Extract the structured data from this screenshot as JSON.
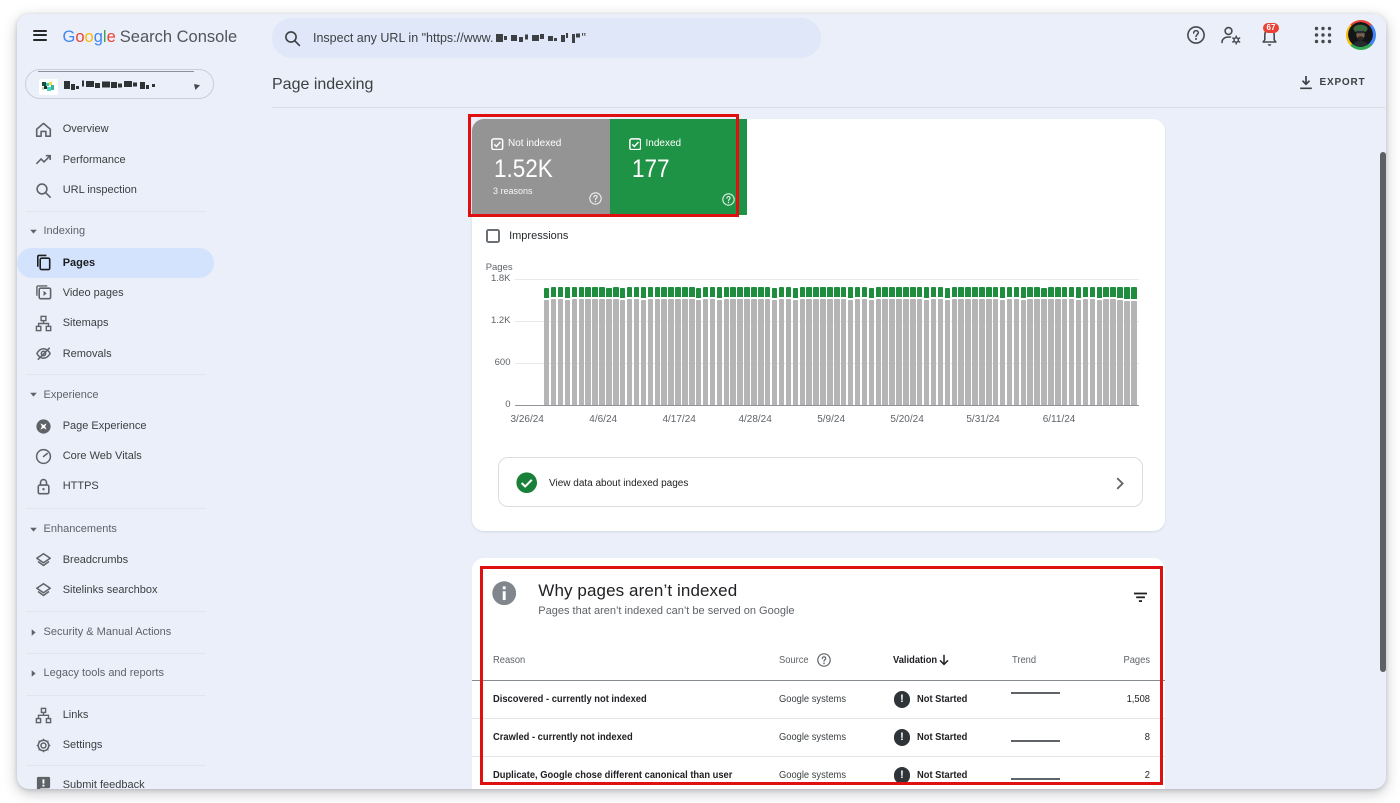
{
  "colors": {
    "window_bg": "#eaeff9",
    "search_bg": "#dfe7f8",
    "selected_pill": "#d3e3fd",
    "tile_gray": "#949494",
    "tile_green": "#1f9345",
    "bar_gray": "#b5b5b5",
    "bar_green": "#1e8e3e",
    "check_green": "#188038",
    "badge_red": "#e94235",
    "annotation_red": "#e01010"
  },
  "topbar": {
    "logo_google_letters": [
      {
        "ch": "G",
        "color": "#4285F4"
      },
      {
        "ch": "o",
        "color": "#EA4335"
      },
      {
        "ch": "o",
        "color": "#FBBC05"
      },
      {
        "ch": "g",
        "color": "#4285F4"
      },
      {
        "ch": "l",
        "color": "#34A853"
      },
      {
        "ch": "e",
        "color": "#EA4335"
      }
    ],
    "logo_suffix": "Search Console",
    "search_placeholder_prefix": "Inspect any URL in \"https://www.",
    "search_placeholder_suffix": "\"",
    "notifications_count": "67"
  },
  "page_header": {
    "title": "Page indexing",
    "export_label": "EXPORT"
  },
  "sidebar": {
    "items": [
      {
        "type": "item",
        "icon": "home-icon",
        "label": "Overview"
      },
      {
        "type": "item",
        "icon": "performance-icon",
        "label": "Performance"
      },
      {
        "type": "item",
        "icon": "url-inspection-icon",
        "label": "URL inspection"
      },
      {
        "type": "divider"
      },
      {
        "type": "section",
        "label": "Indexing",
        "expanded": true
      },
      {
        "type": "item",
        "icon": "pages-icon",
        "label": "Pages",
        "selected": true
      },
      {
        "type": "item",
        "icon": "video-pages-icon",
        "label": "Video pages"
      },
      {
        "type": "item",
        "icon": "sitemaps-icon",
        "label": "Sitemaps"
      },
      {
        "type": "item",
        "icon": "removals-icon",
        "label": "Removals"
      },
      {
        "type": "divider"
      },
      {
        "type": "section",
        "label": "Experience",
        "expanded": true
      },
      {
        "type": "item",
        "icon": "page-experience-icon",
        "label": "Page Experience"
      },
      {
        "type": "item",
        "icon": "core-web-vitals-icon",
        "label": "Core Web Vitals"
      },
      {
        "type": "item",
        "icon": "https-icon",
        "label": "HTTPS"
      },
      {
        "type": "divider"
      },
      {
        "type": "section",
        "label": "Enhancements",
        "expanded": true
      },
      {
        "type": "item",
        "icon": "layers-icon",
        "label": "Breadcrumbs"
      },
      {
        "type": "item",
        "icon": "layers-icon",
        "label": "Sitelinks searchbox"
      },
      {
        "type": "divider"
      },
      {
        "type": "section",
        "label": "Security & Manual Actions",
        "expanded": false
      },
      {
        "type": "divider"
      },
      {
        "type": "section",
        "label": "Legacy tools and reports",
        "expanded": false
      },
      {
        "type": "divider"
      },
      {
        "type": "item",
        "icon": "links-icon",
        "label": "Links"
      },
      {
        "type": "item",
        "icon": "settings-icon",
        "label": "Settings"
      },
      {
        "type": "divider"
      },
      {
        "type": "item",
        "icon": "feedback-icon",
        "label": "Submit feedback"
      }
    ]
  },
  "summary_tiles": [
    {
      "label": "Not indexed",
      "value": "1.52K",
      "sub": "3 reasons",
      "checked": true
    },
    {
      "label": "Indexed",
      "value": "177",
      "sub": "",
      "checked": true
    }
  ],
  "impressions": {
    "label": "Impressions",
    "checked": false
  },
  "chart_data": {
    "type": "bar",
    "stacked": true,
    "title": "",
    "xlabel": "",
    "ylabel": "Pages",
    "ylim": [
      0,
      1800
    ],
    "y_ticks": [
      {
        "label": "1.8K",
        "value": 1800
      },
      {
        "label": "1.2K",
        "value": 1200
      },
      {
        "label": "600",
        "value": 600
      },
      {
        "label": "0",
        "value": 0
      }
    ],
    "x": [
      "3/26/24",
      "3/27/24",
      "3/28/24",
      "3/29/24",
      "3/30/24",
      "3/31/24",
      "4/1/24",
      "4/2/24",
      "4/3/24",
      "4/4/24",
      "4/5/24",
      "4/6/24",
      "4/7/24",
      "4/8/24",
      "4/9/24",
      "4/10/24",
      "4/11/24",
      "4/12/24",
      "4/13/24",
      "4/14/24",
      "4/15/24",
      "4/16/24",
      "4/17/24",
      "4/18/24",
      "4/19/24",
      "4/20/24",
      "4/21/24",
      "4/22/24",
      "4/23/24",
      "4/24/24",
      "4/25/24",
      "4/26/24",
      "4/27/24",
      "4/28/24",
      "4/29/24",
      "4/30/24",
      "5/1/24",
      "5/2/24",
      "5/3/24",
      "5/4/24",
      "5/5/24",
      "5/6/24",
      "5/7/24",
      "5/8/24",
      "5/9/24",
      "5/10/24",
      "5/11/24",
      "5/12/24",
      "5/13/24",
      "5/14/24",
      "5/15/24",
      "5/16/24",
      "5/17/24",
      "5/18/24",
      "5/19/24",
      "5/20/24",
      "5/21/24",
      "5/22/24",
      "5/23/24",
      "5/24/24",
      "5/25/24",
      "5/26/24",
      "5/27/24",
      "5/28/24",
      "5/29/24",
      "5/30/24",
      "5/31/24",
      "6/1/24",
      "6/2/24",
      "6/3/24",
      "6/4/24",
      "6/5/24",
      "6/6/24",
      "6/7/24",
      "6/8/24",
      "6/9/24",
      "6/10/24",
      "6/11/24",
      "6/12/24",
      "6/13/24",
      "6/14/24",
      "6/15/24",
      "6/16/24",
      "6/17/24",
      "6/18/24",
      "6/19/24"
    ],
    "x_tick_labels": [
      "3/26/24",
      "4/6/24",
      "4/17/24",
      "4/28/24",
      "5/9/24",
      "5/20/24",
      "5/31/24",
      "6/11/24"
    ],
    "x_tick_every": 11,
    "grid": true,
    "legend_position": "top-tiles",
    "series": [
      {
        "name": "Not indexed",
        "color": "#b5b5b5",
        "values": [
          1500,
          1504,
          1508,
          1501,
          1505,
          1509,
          1502,
          1506,
          1510,
          1503,
          1507,
          1500,
          1504,
          1508,
          1501,
          1505,
          1509,
          1502,
          1506,
          1510,
          1503,
          1507,
          1500,
          1504,
          1508,
          1501,
          1505,
          1509,
          1502,
          1506,
          1510,
          1503,
          1507,
          1500,
          1504,
          1508,
          1501,
          1505,
          1509,
          1502,
          1506,
          1510,
          1503,
          1507,
          1500,
          1504,
          1508,
          1501,
          1505,
          1509,
          1502,
          1506,
          1510,
          1503,
          1507,
          1500,
          1504,
          1508,
          1501,
          1505,
          1509,
          1502,
          1506,
          1510,
          1503,
          1507,
          1500,
          1504,
          1508,
          1501,
          1505,
          1509,
          1502,
          1506,
          1510,
          1503,
          1507,
          1500,
          1504,
          1508,
          1501,
          1505,
          1509,
          1492,
          1484,
          1479
        ]
      },
      {
        "name": "Indexed",
        "color": "#1e8e3e",
        "values": [
          169,
          174,
          170,
          175,
          171,
          176,
          172,
          177,
          173,
          169,
          174,
          170,
          175,
          171,
          176,
          172,
          177,
          173,
          169,
          174,
          170,
          175,
          171,
          176,
          172,
          177,
          173,
          169,
          174,
          170,
          175,
          171,
          176,
          172,
          177,
          173,
          169,
          174,
          170,
          175,
          171,
          176,
          172,
          177,
          173,
          169,
          174,
          170,
          175,
          171,
          176,
          172,
          177,
          173,
          169,
          174,
          170,
          175,
          171,
          176,
          172,
          177,
          173,
          169,
          174,
          170,
          175,
          171,
          176,
          172,
          177,
          173,
          169,
          174,
          170,
          175,
          171,
          176,
          172,
          177,
          173,
          169,
          174,
          186,
          194,
          199
        ]
      }
    ]
  },
  "view_data": {
    "label": "View data about indexed pages"
  },
  "why_card": {
    "title": "Why pages aren’t indexed",
    "subtitle": "Pages that aren’t indexed can’t be served on Google",
    "columns": {
      "reason": "Reason",
      "source": "Source",
      "validation": "Validation",
      "trend": "Trend",
      "pages": "Pages"
    },
    "sorted_by": "Validation",
    "rows": [
      {
        "reason": "Discovered - currently not indexed",
        "source": "Google systems",
        "validation": "Not Started",
        "pages": "1,508",
        "trend_offset": -7.5
      },
      {
        "reason": "Crawled - currently not indexed",
        "source": "Google systems",
        "validation": "Not Started",
        "pages": "8",
        "trend_offset": 2.7
      },
      {
        "reason": "Duplicate, Google chose different canonical than user",
        "source": "Google systems",
        "validation": "Not Started",
        "pages": "2",
        "trend_offset": 2.3
      }
    ]
  }
}
